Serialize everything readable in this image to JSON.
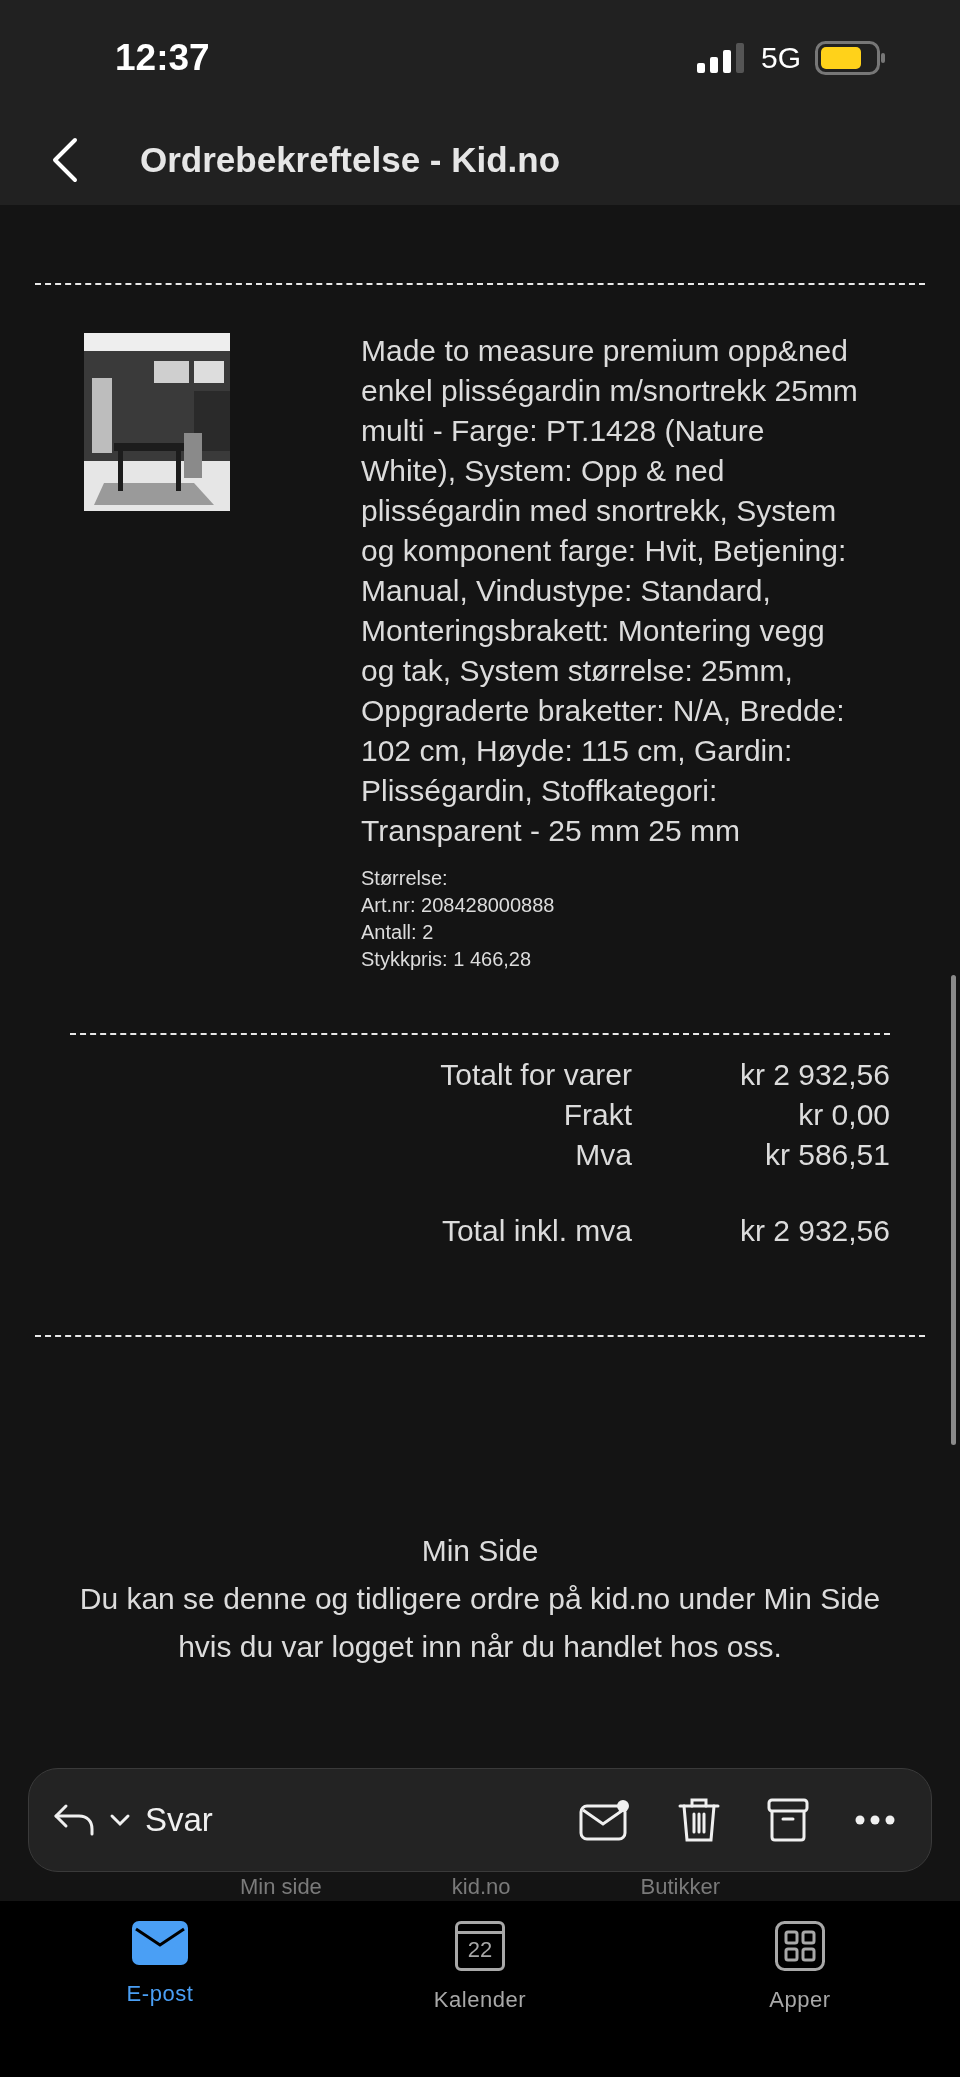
{
  "status_bar": {
    "time": "12:37",
    "network": "5G"
  },
  "nav": {
    "title": "Ordrebekreftelse - Kid.no"
  },
  "product": {
    "description": "Made to measure premium opp&ned enkel plisségardin m/snortrekk 25mm multi - Farge: PT.1428 (Nature White), System: Opp & ned plisségardin med snortrekk, System og komponent farge: Hvit, Betjening: Manual, Vindustype: Standard, Monteringsbrakett: Montering vegg og tak, System størrelse: 25mm, Oppgraderte braketter: N/A, Bredde: 102 cm, Høyde: 115 cm, Gardin: Plisségardin, Stoffkategori: Transparent - 25 mm 25 mm",
    "details": [
      "Størrelse:",
      "Art.nr: 208428000888",
      "Antall: 2",
      "Stykkpris: 1 466,28"
    ]
  },
  "totals": [
    {
      "label": "Totalt for varer",
      "value": "kr 2 932,56"
    },
    {
      "label": "Frakt",
      "value": "kr 0,00"
    },
    {
      "label": "Mva",
      "value": "kr 586,51"
    }
  ],
  "grand_total": {
    "label": "Total inkl. mva",
    "value": "kr 2 932,56"
  },
  "min_side": {
    "title": "Min Side",
    "text": "Du kan se denne og tidligere ordre på kid.no under Min Side hvis du var logget inn når du handlet hos oss."
  },
  "footer_links": [
    "Min side",
    "kid.no",
    "Butikker"
  ],
  "toolbar": {
    "reply_label": "Svar"
  },
  "tabs": [
    {
      "label": "E-post",
      "selected": true
    },
    {
      "label": "Kalender",
      "icon_text": "22",
      "selected": false
    },
    {
      "label": "Apper",
      "selected": false
    }
  ]
}
